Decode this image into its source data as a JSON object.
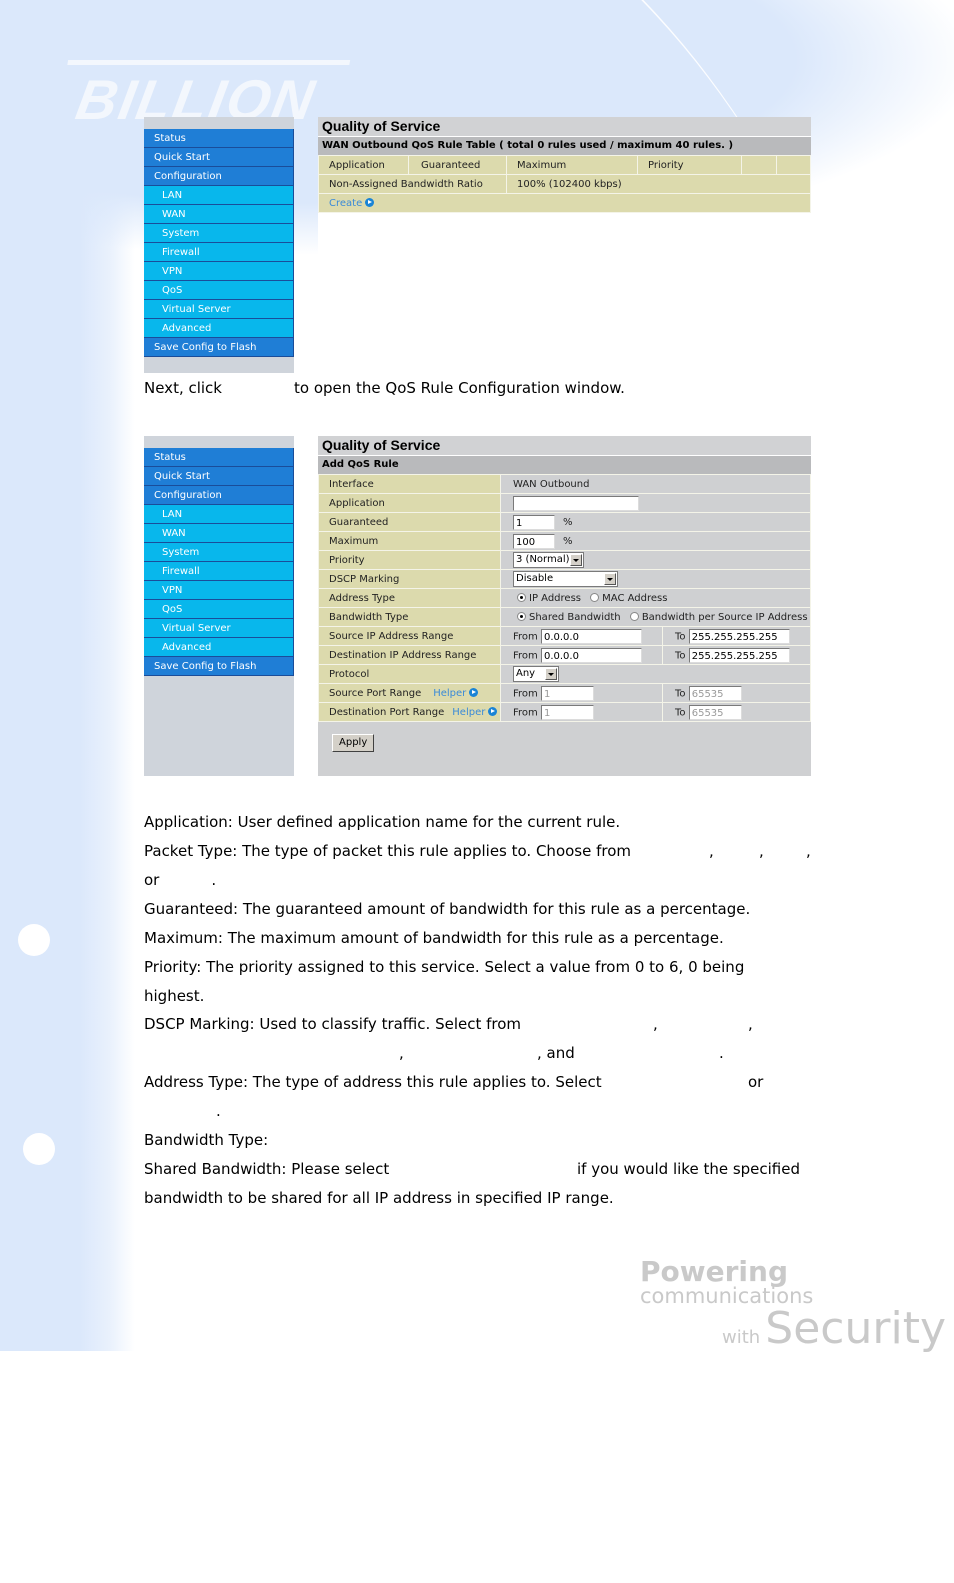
{
  "branding": {
    "logo": "BILLION",
    "tagline_bold": "Powering",
    "tagline_1": "communications",
    "tagline_2": "with",
    "tagline_3": "Security"
  },
  "nav": {
    "items": [
      {
        "label": "Status",
        "level": "main"
      },
      {
        "label": "Quick Start",
        "level": "main"
      },
      {
        "label": "Configuration",
        "level": "main"
      },
      {
        "label": "LAN",
        "level": "sub"
      },
      {
        "label": "WAN",
        "level": "sub"
      },
      {
        "label": "System",
        "level": "sub"
      },
      {
        "label": "Firewall",
        "level": "sub"
      },
      {
        "label": "VPN",
        "level": "sub"
      },
      {
        "label": "QoS",
        "level": "sub"
      },
      {
        "label": "Virtual Server",
        "level": "sub"
      },
      {
        "label": "Advanced",
        "level": "sub"
      },
      {
        "label": "Save Config to Flash",
        "level": "main"
      }
    ]
  },
  "screen1": {
    "title": "Quality of Service",
    "table_caption": "WAN Outbound QoS Rule Table ( total 0 rules used / maximum 40 rules. )",
    "columns": [
      "Application",
      "Guaranteed",
      "Maximum",
      "Priority",
      "",
      ""
    ],
    "non_assigned_label": "Non-Assigned Bandwidth Ratio",
    "non_assigned_value": "100% (102400 kbps)",
    "create_link": "Create"
  },
  "instruction": {
    "before": "Next, click",
    "after": "to open the QoS Rule Configuration window."
  },
  "screen2": {
    "title": "Quality of Service",
    "subtitle": "Add QoS Rule",
    "interface_label": "Interface",
    "interface_value": "WAN Outbound",
    "application_label": "Application",
    "application_value": "",
    "guaranteed_label": "Guaranteed",
    "guaranteed_value": "1",
    "maximum_label": "Maximum",
    "maximum_value": "100",
    "percent": "%",
    "priority_label": "Priority",
    "priority_value": "3 (Normal)",
    "dscp_label": "DSCP Marking",
    "dscp_value": "Disable",
    "address_type_label": "Address Type",
    "address_type_options": [
      "IP Address",
      "MAC Address"
    ],
    "address_type_selected": "IP Address",
    "bandwidth_type_label": "Bandwidth Type",
    "bandwidth_type_options": [
      "Shared Bandwidth",
      "Bandwidth per Source IP Address"
    ],
    "bandwidth_type_selected": "Shared Bandwidth",
    "src_ip_label": "Source IP Address Range",
    "src_ip_from": "0.0.0.0",
    "src_ip_to": "255.255.255.255",
    "dst_ip_label": "Destination IP Address Range",
    "dst_ip_from": "0.0.0.0",
    "dst_ip_to": "255.255.255.255",
    "protocol_label": "Protocol",
    "protocol_value": "Any",
    "src_port_label": "Source Port Range",
    "src_port_from": "1",
    "src_port_to": "65535",
    "dst_port_label": "Destination Port Range",
    "dst_port_from": "1",
    "dst_port_to": "65535",
    "helper_link": "Helper",
    "from_label": "From",
    "to_label": "To",
    "apply_button": "Apply"
  },
  "descriptions": {
    "application": "Application: User defined application name for the current rule.",
    "packet_type": "Packet Type: The type of packet this rule applies to. Choose from",
    "packet_type_or": "or",
    "guaranteed": "Guaranteed: The guaranteed amount of bandwidth for this rule as a percentage.",
    "maximum": "Maximum: The maximum amount of bandwidth for this rule as a percentage.",
    "priority_1": "Priority: The priority assigned to this service. Select a value from 0 to 6, 0 being",
    "priority_2": "highest.",
    "dscp": "DSCP Marking: Used to classify traffic. Select from",
    "dscp_and": ", and",
    "address_type": "Address Type: The type of address this rule applies to. Select",
    "address_type_or": "or",
    "bandwidth_type": "Bandwidth Type:",
    "shared_1": "Shared Bandwidth: Please select",
    "shared_1b": "if you would like the specified",
    "shared_2": "bandwidth to be shared for all IP address in specified IP range."
  }
}
